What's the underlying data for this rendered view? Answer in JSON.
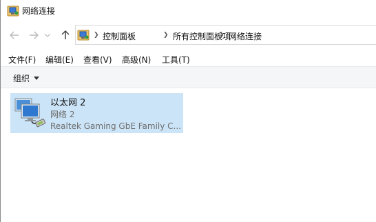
{
  "window": {
    "title": "网络连接"
  },
  "address": {
    "breadcrumbs": [
      "控制面板",
      "所有控制面板项",
      "网络连接"
    ]
  },
  "menu": [
    "文件(F)",
    "编辑(E)",
    "查看(V)",
    "高级(N)",
    "工具(T)"
  ],
  "toolbar": {
    "organize_label": "组织"
  },
  "connections": [
    {
      "name": "以太网 2",
      "network": "网络 2",
      "device": "Realtek Gaming GbE Family C..."
    }
  ],
  "colors": {
    "selection": "#cce4f7",
    "toolbar_bg": "#f4f6f8",
    "disabled_nav": "#b9b9b9"
  }
}
